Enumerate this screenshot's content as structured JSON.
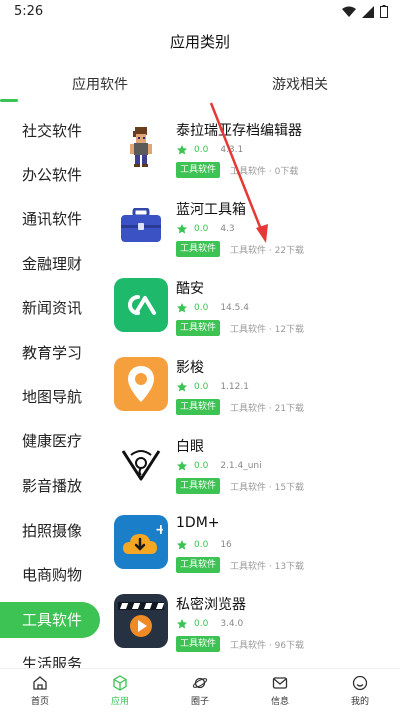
{
  "status": {
    "time": "5:26"
  },
  "header": {
    "title": "应用类别"
  },
  "tabs": [
    {
      "label": "应用软件"
    },
    {
      "label": "游戏相关"
    }
  ],
  "categories": [
    {
      "label": "社交软件"
    },
    {
      "label": "办公软件"
    },
    {
      "label": "通讯软件"
    },
    {
      "label": "金融理财"
    },
    {
      "label": "新闻资讯"
    },
    {
      "label": "教育学习"
    },
    {
      "label": "地图导航"
    },
    {
      "label": "健康医疗"
    },
    {
      "label": "影音播放"
    },
    {
      "label": "拍照摄像"
    },
    {
      "label": "电商购物"
    },
    {
      "label": "工具软件"
    },
    {
      "label": "生活服务"
    }
  ],
  "active_category": "工具软件",
  "apps": [
    {
      "name": "泰拉瑞亚存档编辑器",
      "score": "0.0",
      "version": "4.3.1",
      "tag": "工具软件",
      "meta": "工具软件 · 0下载",
      "icon": "terraria-character-icon"
    },
    {
      "name": "蓝河工具箱",
      "score": "0.0",
      "version": "4.3",
      "tag": "工具软件",
      "meta": "工具软件 · 22下载",
      "icon": "toolbox-icon"
    },
    {
      "name": "酷安",
      "score": "0.0",
      "version": "14.5.4",
      "tag": "工具软件",
      "meta": "工具软件 · 12下载",
      "icon": "coolapk-icon"
    },
    {
      "name": "影梭",
      "score": "0.0",
      "version": "1.12.1",
      "tag": "工具软件",
      "meta": "工具软件 · 21下载",
      "icon": "location-pin-icon"
    },
    {
      "name": "白眼",
      "score": "0.0",
      "version": "2.1.4_uni",
      "tag": "工具软件",
      "meta": "工具软件 · 15下载",
      "icon": "eye-logo-icon"
    },
    {
      "name": "1DM+",
      "score": "0.0",
      "version": "16",
      "tag": "工具软件",
      "meta": "工具软件 · 13下载",
      "icon": "cloud-download-icon"
    },
    {
      "name": "私密浏览器",
      "score": "0.0",
      "version": "3.4.0",
      "tag": "工具软件",
      "meta": "工具软件 · 96下载",
      "icon": "video-play-icon"
    }
  ],
  "bottom_nav": [
    {
      "label": "首页",
      "icon": "home-icon"
    },
    {
      "label": "应用",
      "icon": "cube-icon"
    },
    {
      "label": "圈子",
      "icon": "planet-icon"
    },
    {
      "label": "信息",
      "icon": "mail-icon"
    },
    {
      "label": "我的",
      "icon": "smile-icon"
    }
  ],
  "colors": {
    "accent": "#3cc353",
    "annotation_arrow": "#e53935"
  }
}
